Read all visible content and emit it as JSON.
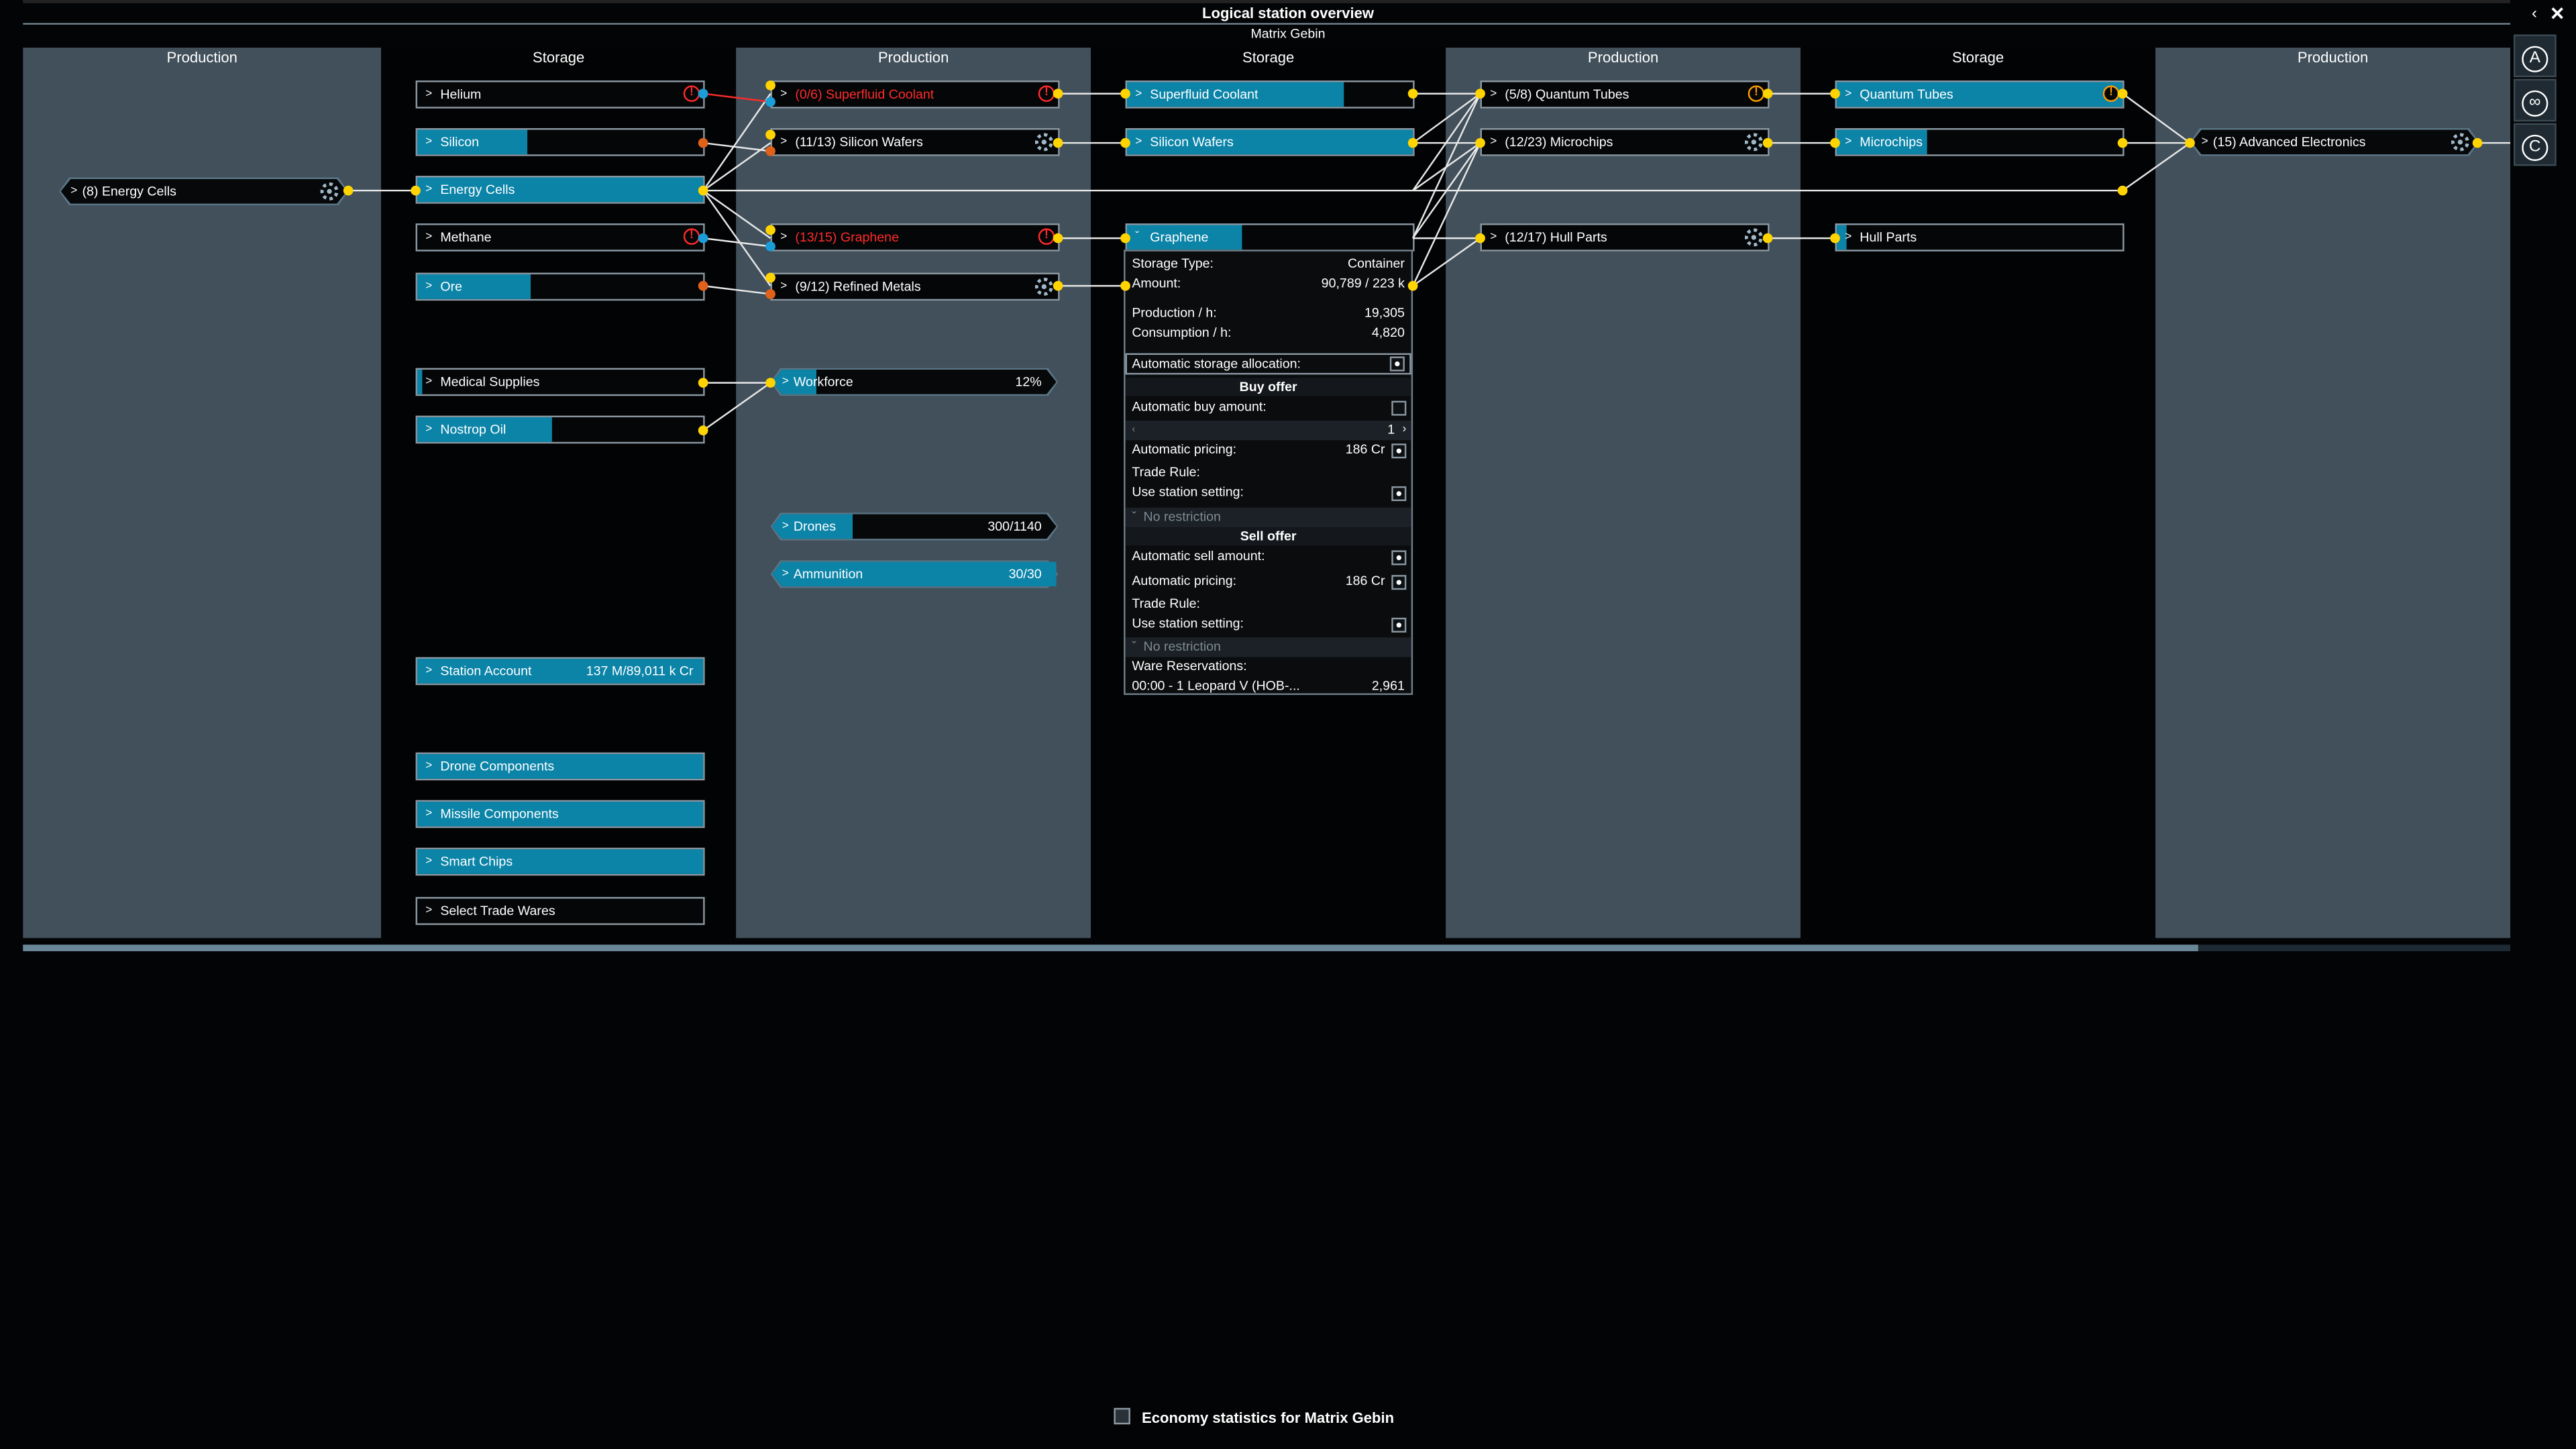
{
  "header": {
    "title": "Logical station overview",
    "station": "Matrix Gebin"
  },
  "columns": [
    "Production",
    "Storage",
    "Production",
    "Storage",
    "Production",
    "Storage",
    "Production"
  ],
  "production1": {
    "energy_cells": "(8) Energy Cells"
  },
  "storage1": {
    "helium": "Helium",
    "silicon": "Silicon",
    "energy_cells": "Energy Cells",
    "methane": "Methane",
    "ore": "Ore",
    "medical_supplies": "Medical Supplies",
    "nostrop_oil": "Nostrop Oil",
    "station_account": "Station Account",
    "station_account_value": "137 M/89,011 k Cr",
    "drone_components": "Drone Components",
    "missile_components": "Missile Components",
    "smart_chips": "Smart Chips",
    "select_trade_wares": "Select Trade Wares"
  },
  "production2": {
    "superfluid_coolant": "(0/6) Superfluid Coolant",
    "silicon_wafers": "(11/13) Silicon Wafers",
    "graphene": "(13/15) Graphene",
    "refined_metals": "(9/12) Refined Metals",
    "workforce": "Workforce",
    "workforce_value": "12%",
    "workforce_level": 0.12,
    "drones": "Drones",
    "drones_value": "300/1140",
    "ammunition": "Ammunition",
    "ammunition_value": "30/30"
  },
  "storage2": {
    "superfluid_coolant": "Superfluid Coolant",
    "silicon_wafers": "Silicon Wafers",
    "graphene": "Graphene"
  },
  "popup": {
    "storage_type_label": "Storage Type:",
    "storage_type_value": "Container",
    "amount_label": "Amount:",
    "amount_value": "90,789 / 223 k",
    "production_label": "Production / h:",
    "production_value": "19,305",
    "consumption_label": "Consumption / h:",
    "consumption_value": "4,820",
    "auto_storage_label": "Automatic storage allocation:",
    "buy_offer_title": "Buy offer",
    "auto_buy_label": "Automatic buy amount:",
    "buy_amount_value": "1",
    "buy_pricing_label": "Automatic pricing:",
    "buy_pricing_value": "186 Cr",
    "buy_trade_rule_label": "Trade Rule:",
    "buy_station_setting_label": "Use station setting:",
    "buy_no_restriction": "No restriction",
    "sell_offer_title": "Sell offer",
    "auto_sell_label": "Automatic sell amount:",
    "sell_pricing_label": "Automatic pricing:",
    "sell_pricing_value": "186 Cr",
    "sell_trade_rule_label": "Trade Rule:",
    "sell_station_setting_label": "Use station setting:",
    "sell_no_restriction": "No restriction",
    "ware_reservations_label": "Ware Reservations:",
    "reservation_label": "00:00 - 1 Leopard V (HOB-...",
    "reservation_value": "2,961"
  },
  "production3": {
    "quantum_tubes": "(5/8) Quantum Tubes",
    "microchips": "(12/23) Microchips",
    "hull_parts": "(12/17) Hull Parts"
  },
  "storage3": {
    "quantum_tubes": "Quantum Tubes",
    "microchips": "Microchips",
    "hull_parts": "Hull Parts"
  },
  "production4": {
    "advanced_electronics": "(15) Advanced Electronics"
  },
  "side_buttons": {
    "a": "A",
    "c": "C"
  },
  "footer": {
    "economy_stats": "Economy statistics for Matrix Gebin"
  },
  "colors": {
    "accent": "#0b84a8",
    "warning": "#ff2b2b",
    "alert": "#ff9c00",
    "connector": "#ffd400"
  }
}
